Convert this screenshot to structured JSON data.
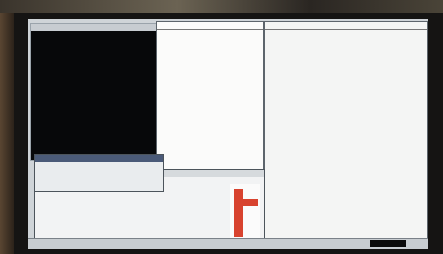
{
  "photo": {
    "subject": "monitor-displaying-desktop"
  },
  "screen": {
    "console": {
      "lines": [
        "",
        "",
        "",
        "",
        "",
        "",
        "",
        "",
        "",
        "",
        "",
        "",
        "",
        "",
        "",
        "",
        "",
        "",
        "",
        "",
        "",
        "",
        "",
        "",
        ""
      ]
    },
    "listing": {
      "lines": [
        "",
        "",
        "",
        "",
        "",
        "",
        "",
        "",
        "",
        "",
        "",
        "",
        "",
        "",
        "",
        "",
        "",
        "",
        "",
        "",
        "",
        "",
        "",
        "",
        "",
        "",
        "",
        "",
        "",
        "",
        ""
      ]
    },
    "table": {
      "rows": [
        [
          "",
          "",
          ""
        ],
        [
          "",
          "",
          ""
        ],
        [
          "",
          "",
          ""
        ],
        [
          "",
          "",
          ""
        ],
        [
          "",
          "",
          ""
        ],
        [
          "",
          "",
          ""
        ],
        [
          "",
          "",
          ""
        ],
        [
          "",
          "",
          ""
        ],
        [
          "",
          "",
          ""
        ],
        [
          "",
          "",
          ""
        ],
        [
          "",
          "",
          ""
        ],
        [
          "",
          "",
          ""
        ],
        [
          "",
          "",
          ""
        ],
        [
          "",
          "",
          ""
        ],
        [
          "",
          "",
          ""
        ],
        [
          "",
          "",
          ""
        ],
        [
          "",
          "",
          ""
        ],
        [
          "",
          "",
          ""
        ],
        [
          "",
          "",
          ""
        ],
        [
          "",
          "",
          ""
        ],
        [
          "",
          "",
          ""
        ],
        [
          "",
          "",
          ""
        ],
        [
          "",
          "",
          ""
        ],
        [
          "",
          "",
          ""
        ],
        [
          "",
          "",
          ""
        ],
        [
          "",
          "",
          ""
        ],
        [
          "",
          "",
          ""
        ],
        [
          "",
          "",
          ""
        ],
        [
          "",
          "",
          ""
        ],
        [
          "",
          "",
          ""
        ],
        [
          "",
          "",
          ""
        ],
        [
          "",
          "",
          ""
        ],
        [
          "",
          "",
          ""
        ],
        [
          "",
          "",
          ""
        ],
        [
          "",
          "",
          ""
        ],
        [
          "",
          "",
          ""
        ],
        [
          "",
          "",
          ""
        ],
        [
          "",
          "",
          ""
        ],
        [
          "",
          "",
          ""
        ],
        [
          "",
          "",
          ""
        ],
        [
          "",
          "",
          ""
        ],
        [
          "",
          "",
          ""
        ],
        [
          "",
          "",
          ""
        ]
      ]
    },
    "form": {
      "lines": [
        "",
        "",
        "",
        "",
        "",
        "",
        "",
        "",
        "",
        "",
        "",
        ""
      ]
    },
    "status": ""
  },
  "colors": {
    "screen": "#cfd4d8",
    "console_bg": "#07080a",
    "accent_red": "#d8432f"
  }
}
